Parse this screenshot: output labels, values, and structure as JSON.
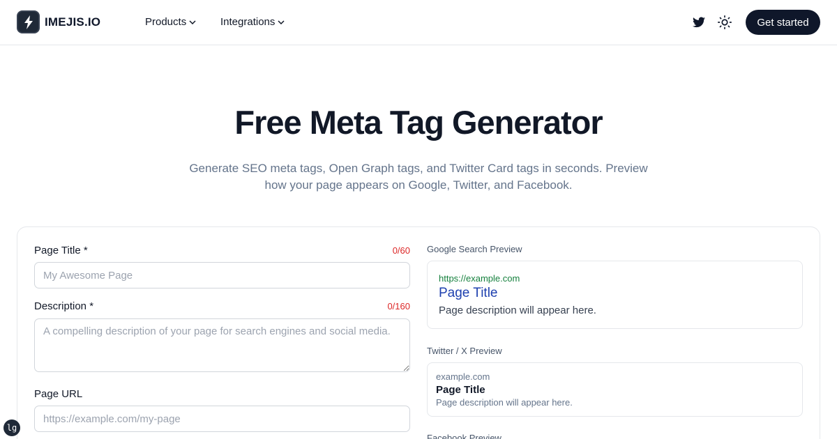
{
  "header": {
    "brand": "IMEJIS.IO",
    "logo_icon": "lightning-bolt-icon",
    "nav": [
      {
        "label": "Products",
        "icon": "chevron-down-icon"
      },
      {
        "label": "Integrations",
        "icon": "chevron-down-icon"
      }
    ],
    "twitter_icon": "twitter-icon",
    "theme_icon": "sun-icon",
    "cta_label": "Get started"
  },
  "hero": {
    "title": "Free Meta Tag Generator",
    "subtitle_line1": "Generate SEO meta tags, Open Graph tags, and Twitter Card tags in seconds. Preview",
    "subtitle_line2": "how your page appears on Google, Twitter, and Facebook."
  },
  "form": {
    "page_title": {
      "label": "Page Title *",
      "counter": "0/60",
      "value": "",
      "placeholder": "My Awesome Page"
    },
    "description": {
      "label": "Description *",
      "counter": "0/160",
      "value": "",
      "placeholder": "A compelling description of your page for search engines and social media."
    },
    "page_url": {
      "label": "Page URL",
      "value": "",
      "placeholder": "https://example.com/my-page"
    }
  },
  "previews": {
    "google": {
      "label": "Google Search Preview",
      "url": "https://example.com",
      "title": "Page Title",
      "description": "Page description will appear here."
    },
    "twitter": {
      "label": "Twitter / X Preview",
      "domain": "example.com",
      "title": "Page Title",
      "description": "Page description will appear here."
    },
    "facebook": {
      "label": "Facebook Preview"
    }
  },
  "badge": {
    "label": "lg"
  },
  "colors": {
    "accent": "#0f172a",
    "counter": "#dc2626",
    "google_url": "#15803d",
    "google_title": "#1e40af"
  }
}
